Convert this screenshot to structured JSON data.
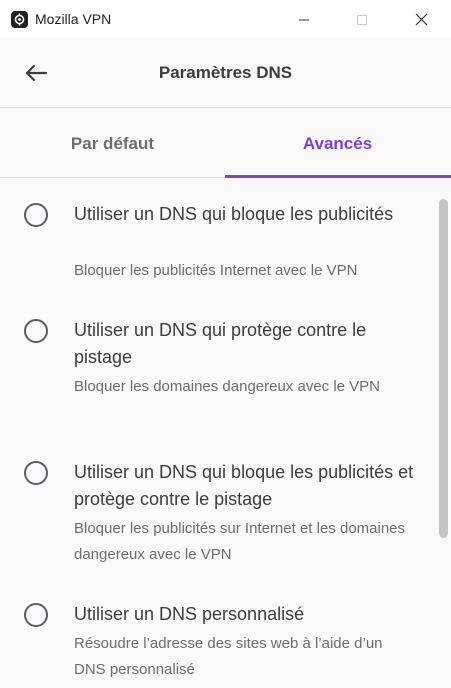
{
  "window": {
    "title": "Mozilla VPN",
    "app_icon": "mozilla-vpn-icon"
  },
  "header": {
    "title": "Paramètres DNS",
    "back_icon": "arrow-left-icon"
  },
  "tabs": [
    {
      "label": "Par défaut",
      "selected": false
    },
    {
      "label": "Avancés",
      "selected": true
    }
  ],
  "options": [
    {
      "title": "Utiliser un DNS qui bloque les publicités",
      "description": "Bloquer les publicités Internet avec le VPN",
      "selected": false
    },
    {
      "title": "Utiliser un DNS qui protège contre le pistage",
      "description": "Bloquer les domaines dangereux avec le VPN",
      "selected": false
    },
    {
      "title": "Utiliser un DNS qui bloque les publicités et protège contre le pistage",
      "description": "Bloquer les publicités sur Internet et les domaines dangereux avec le VPN",
      "selected": false
    },
    {
      "title": "Utiliser un DNS personnalisé",
      "description": "Résoudre l’adresse des sites web à l’aide d’un DNS personnalisé",
      "selected": false
    }
  ],
  "colors": {
    "accent": "#7542e5",
    "text": "#3d3d3d",
    "muted": "#6d6d6e"
  }
}
